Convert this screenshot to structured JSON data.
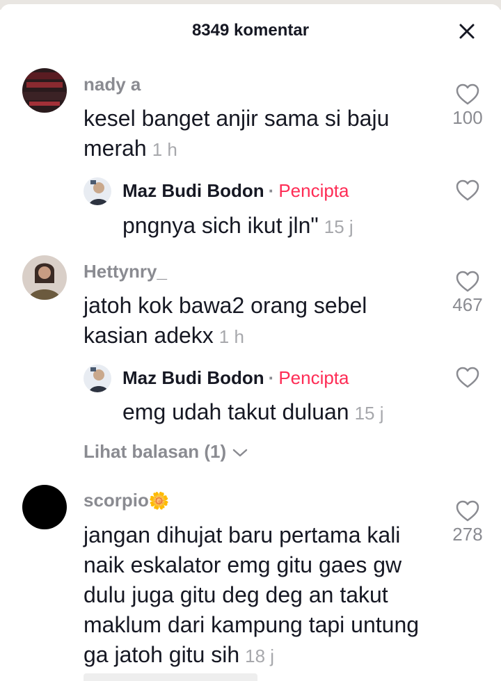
{
  "header": {
    "title": "8349 komentar",
    "close_icon": "close-icon"
  },
  "comments": [
    {
      "username": "nady a",
      "text": "kesel banget anjir sama si baju merah",
      "time": "1 h",
      "likes": "100",
      "reply": {
        "username": "Maz Budi Bodon",
        "badge": "Pencipta",
        "text": "pngnya sich ikut jln\"",
        "time": "15 j"
      }
    },
    {
      "username": "Hettynry_",
      "text": "jatoh kok bawa2 orang sebel kasian adekx",
      "time": "1 h",
      "likes": "467",
      "reply": {
        "username": "Maz Budi Bodon",
        "badge": "Pencipta",
        "text": "emg udah takut duluan",
        "time": "15 j"
      },
      "view_replies": "Lihat balasan (1)"
    },
    {
      "username": "scorpio",
      "username_emoji": "🌼",
      "text": "jangan dihujat baru pertama kali naik eskalator emg gitu gaes gw dulu juga gitu deg deg an takut maklum dari kampung tapi untung ga jatoh gitu sih",
      "time": "18 j",
      "likes": "278"
    }
  ],
  "colors": {
    "accent": "#fe2c55",
    "muted": "#8a8b91",
    "text": "#161823"
  }
}
